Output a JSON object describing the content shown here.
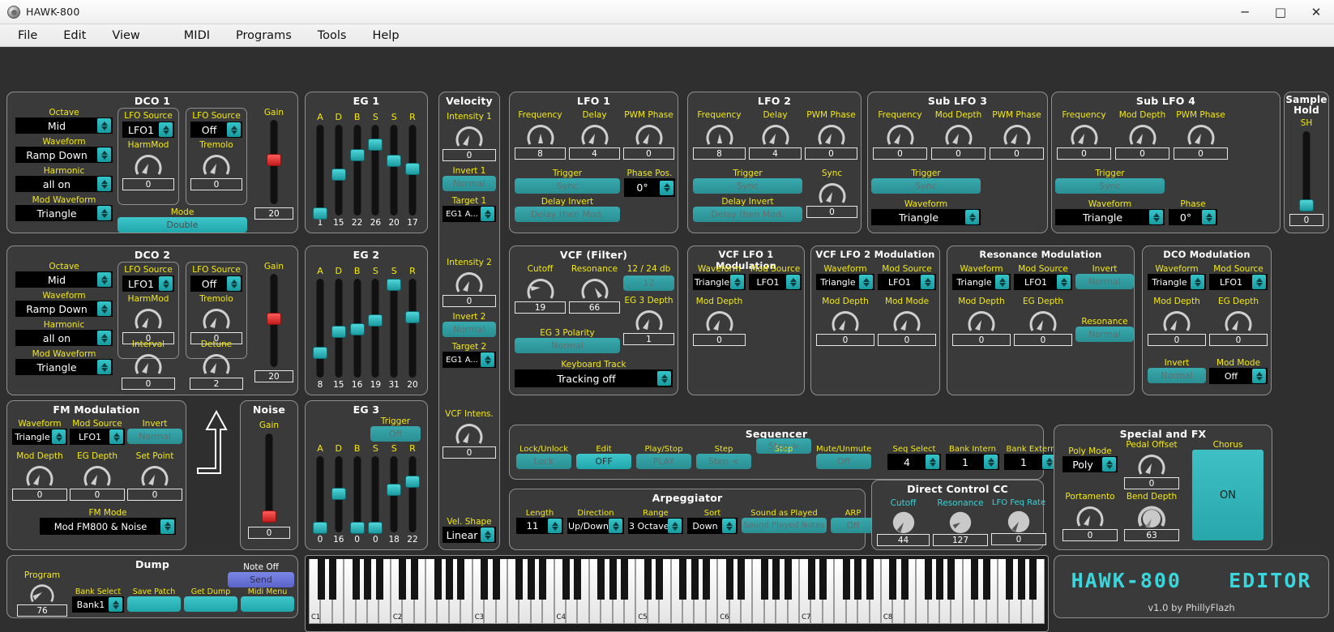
{
  "window": {
    "title": "HAWK-800",
    "icon": "app-icon",
    "minimize": "─",
    "maximize": "□",
    "close": "✕"
  },
  "menu": [
    "File",
    "Edit",
    "View",
    "MIDI",
    "Programs",
    "Tools",
    "Help"
  ],
  "colors": {
    "teal": "#2fb3b8",
    "yellow": "#f2e916",
    "cyan_label": "#3fd0d4",
    "panel_bg": "#3a3a3a",
    "workspace_bg": "#2f2f2f",
    "red_slider": "#d42020"
  },
  "dco1": {
    "title": "DCO 1",
    "octave_label": "Octave",
    "octave_value": "Mid",
    "waveform_label": "Waveform",
    "waveform_value": "Ramp Down",
    "harmonic_label": "Harmonic",
    "harmonic_value": "all on",
    "mod_waveform_label": "Mod Waveform",
    "mod_waveform_value": "Triangle",
    "lfo_source_a_label": "LFO Source",
    "lfo_source_a_value": "LFO1",
    "harmmod_label": "HarmMod",
    "harmmod_value": "0",
    "lfo_source_b_label": "LFO Source",
    "lfo_source_b_value": "Off",
    "tremolo_label": "Tremolo",
    "tremolo_value": "0",
    "mode_label": "Mode",
    "mode_value": "Double",
    "gain_label": "Gain",
    "gain_value": "20"
  },
  "dco2": {
    "title": "DCO 2",
    "octave_label": "Octave",
    "octave_value": "Mid",
    "waveform_label": "Waveform",
    "waveform_value": "Ramp Down",
    "harmonic_label": "Harmonic",
    "harmonic_value": "all on",
    "mod_waveform_label": "Mod Waveform",
    "mod_waveform_value": "Triangle",
    "lfo_source_a_label": "LFO Source",
    "lfo_source_a_value": "LFO1",
    "harmmod_label": "HarmMod",
    "harmmod_value": "0",
    "lfo_source_b_label": "LFO Source",
    "lfo_source_b_value": "Off",
    "tremolo_label": "Tremolo",
    "tremolo_value": "0",
    "interval_label": "Interval",
    "interval_value": "0",
    "detune_label": "Detune",
    "detune_value": "2",
    "gain_label": "Gain",
    "gain_value": "20"
  },
  "eg1": {
    "title": "EG 1",
    "stages": [
      "A",
      "D",
      "B",
      "S",
      "S",
      "R"
    ],
    "values": [
      1,
      15,
      22,
      26,
      20,
      17
    ],
    "max": 31
  },
  "eg2": {
    "title": "EG 2",
    "stages": [
      "A",
      "D",
      "B",
      "S",
      "S",
      "R"
    ],
    "values": [
      8,
      15,
      16,
      19,
      31,
      20
    ],
    "max": 31
  },
  "eg3": {
    "title": "EG 3",
    "stages": [
      "A",
      "D",
      "B",
      "S",
      "S",
      "R"
    ],
    "values": [
      0,
      16,
      0,
      0,
      18,
      22
    ],
    "max": 31,
    "trigger_label": "Trigger",
    "trigger_value": "Off"
  },
  "velocity": {
    "title": "Velocity",
    "intensity1_label": "Intensity 1",
    "intensity1_value": "0",
    "invert1_label": "Invert 1",
    "invert1_value": "Normal",
    "target1_label": "Target 1",
    "target1_value": "EG1 A...",
    "intensity2_label": "Intensity 2",
    "intensity2_value": "0",
    "invert2_label": "Invert 2",
    "invert2_value": "Normal",
    "target2_label": "Target 2",
    "target2_value": "EG1 A...",
    "vcf_intens_label": "VCF Intens.",
    "vcf_intens_value": "0",
    "vel_shape_label": "Vel. Shape",
    "vel_shape_value": "Linear"
  },
  "lfo1": {
    "title": "LFO 1",
    "frequency_label": "Frequency",
    "frequency_value": "8",
    "delay_label": "Delay",
    "delay_value": "4",
    "pwm_phase_label": "PWM Phase",
    "pwm_phase_value": "0",
    "trigger_label": "Trigger",
    "trigger_value": "Sync",
    "delay_invert_label": "Delay Invert",
    "delay_invert_value": "Delay then Mod.",
    "phase_pos_label": "Phase Pos.",
    "phase_pos_value": "0°"
  },
  "lfo2": {
    "title": "LFO 2",
    "frequency_label": "Frequency",
    "frequency_value": "8",
    "delay_label": "Delay",
    "delay_value": "4",
    "pwm_phase_label": "PWM Phase",
    "pwm_phase_value": "0",
    "trigger_label": "Trigger",
    "trigger_value": "Sync",
    "delay_invert_label": "Delay Invert",
    "delay_invert_value": "Delay then Mod.",
    "sync_label": "Sync",
    "sync_value": "0"
  },
  "sublfo3": {
    "title": "Sub LFO 3",
    "frequency_label": "Frequency",
    "frequency_value": "0",
    "mod_depth_label": "Mod Depth",
    "mod_depth_value": "0",
    "pwm_phase_label": "PWM Phase",
    "pwm_phase_value": "0",
    "trigger_label": "Trigger",
    "trigger_value": "Sync",
    "waveform_label": "Waveform",
    "waveform_value": "Triangle"
  },
  "sublfo4": {
    "title": "Sub LFO 4",
    "frequency_label": "Frequency",
    "frequency_value": "0",
    "mod_depth_label": "Mod Depth",
    "mod_depth_value": "0",
    "pwm_phase_label": "PWM Phase",
    "pwm_phase_value": "0",
    "trigger_label": "Trigger",
    "trigger_value": "Sync",
    "waveform_label": "Waveform",
    "waveform_value": "Triangle",
    "phase_label": "Phase",
    "phase_value": "0°"
  },
  "sample_hold": {
    "title_line1": "Sample",
    "title_line2": "Hold",
    "sh_label": "SH",
    "sh_value": "0"
  },
  "vcf": {
    "title": "VCF (Filter)",
    "cutoff_label": "Cutoff",
    "cutoff_value": "19",
    "resonance_label": "Resonance",
    "resonance_value": "66",
    "db_label": "12 / 24 db",
    "db_value": "12",
    "eg3_depth_label": "EG 3 Depth",
    "eg3_depth_value": "1",
    "eg3_polarity_label": "EG 3 Polarity",
    "eg3_polarity_value": "Normal",
    "keyboard_track_label": "Keyboard Track",
    "keyboard_track_value": "Tracking off"
  },
  "vcf_lfo1_mod": {
    "title": "VCF LFO 1 Modulation",
    "waveform_label": "Waveform",
    "waveform_value": "Triangle",
    "mod_source_label": "Mod Source",
    "mod_source_value": "LFO1",
    "mod_depth_label": "Mod Depth",
    "mod_depth_value": "0"
  },
  "vcf_lfo2_mod": {
    "title": "VCF LFO 2 Modulation",
    "waveform_label": "Waveform",
    "waveform_value": "Triangle",
    "mod_source_label": "Mod Source",
    "mod_source_value": "LFO1",
    "mod_depth_label": "Mod Depth",
    "mod_depth_value": "0",
    "mod_mode_label": "Mod Mode",
    "mod_mode_value": "0"
  },
  "resonance_mod": {
    "title": "Resonance Modulation",
    "waveform_label": "Waveform",
    "waveform_value": "Triangle",
    "mod_source_label": "Mod Source",
    "mod_source_value": "LFO1",
    "invert_label": "Invert",
    "invert_value": "Normal",
    "mod_depth_label": "Mod Depth",
    "mod_depth_value": "0",
    "eg_depth_label": "EG Depth",
    "eg_depth_value": "0",
    "resonance_label": "Resonance",
    "resonance_value": "Normal"
  },
  "dco_mod": {
    "title": "DCO Modulation",
    "waveform_label": "Waveform",
    "waveform_value": "Triangle",
    "mod_source_label": "Mod Source",
    "mod_source_value": "LFO1",
    "mod_depth_label": "Mod Depth",
    "mod_depth_value": "0",
    "eg_depth_label": "EG Depth",
    "eg_depth_value": "0",
    "invert_label": "Invert",
    "invert_value": "Normal",
    "mod_mode_label": "Mod Mode",
    "mod_mode_value": "Off"
  },
  "fm_mod": {
    "title": "FM Modulation",
    "waveform_label": "Waveform",
    "waveform_value": "Triangle",
    "mod_source_label": "Mod Source",
    "mod_source_value": "LFO1",
    "invert_label": "Invert",
    "invert_value": "Normal",
    "mod_depth_label": "Mod Depth",
    "mod_depth_value": "0",
    "eg_depth_label": "EG Depth",
    "eg_depth_value": "0",
    "set_point_label": "Set Point",
    "set_point_value": "0",
    "fm_mode_label": "FM Mode",
    "fm_mode_value": "Mod FM800 & Noise"
  },
  "noise": {
    "title": "Noise",
    "gain_label": "Gain",
    "gain_value": "0"
  },
  "sequencer": {
    "title": "Sequencer",
    "lock_label": "Lock/Unlock",
    "lock_value": "Lock",
    "edit_label": "Edit",
    "edit_value": "OFF",
    "play_label": "Play/Stop",
    "play_value": "PLAY",
    "step_back_label": "Step",
    "step_back_value": "Step <",
    "step_fwd_label": "Step",
    "step_fwd_value": "Step >",
    "mute_label": "Mute/Unmute",
    "mute_value": "Off",
    "seq_select_label": "Seq Select",
    "seq_select_value": "4",
    "bank_intern_label": "Bank Intern",
    "bank_intern_value": "1",
    "bank_extern_label": "Bank Extern",
    "bank_extern_value": "1"
  },
  "arpeggiator": {
    "title": "Arpeggiator",
    "length_label": "Length",
    "length_value": "11",
    "direction_label": "Direction",
    "direction_value": "Up/Down",
    "range_label": "Range",
    "range_value": "3 Octave",
    "sort_label": "Sort",
    "sort_value": "Down",
    "sound_as_played_label": "Sound as Played",
    "sound_as_played_value": "Sound Played Notes",
    "arp_label": "ARP",
    "arp_value": "Off"
  },
  "direct_control": {
    "title": "Direct Control CC",
    "cutoff_label": "Cutoff",
    "cutoff_value": "44",
    "resonance_label": "Resonance",
    "resonance_value": "127",
    "lfo_feq_rate_label": "LFO Feq Rate",
    "lfo_feq_rate_value": "0"
  },
  "special_fx": {
    "title": "Special and FX",
    "poly_mode_label": "Poly Mode",
    "poly_mode_value": "Poly",
    "pedal_offset_label": "Pedal Offset",
    "pedal_offset_value": "0",
    "chorus_label": "Chorus",
    "chorus_value": "ON",
    "portamento_label": "Portamento",
    "portamento_value": "0",
    "bend_depth_label": "Bend Depth",
    "bend_depth_value": "63"
  },
  "dump": {
    "title": "Dump",
    "program_label": "Program",
    "program_value": "76",
    "bank_select_label": "Bank Select",
    "bank_select_value": "Bank1",
    "save_patch_label": "Save Patch",
    "get_dump_label": "Get Dump",
    "midi_menu_label": "Midi Menu",
    "note_off_label": "Note Off",
    "note_off_value": "Send"
  },
  "keyboard": {
    "octave_labels": [
      "C1",
      "C2",
      "C3",
      "C4",
      "C5",
      "C6",
      "C7",
      "C8"
    ]
  },
  "branding": {
    "logo_left": "HAWK-800",
    "logo_right": "EDITOR",
    "version": "v1.0 by PhillyFlazh"
  }
}
